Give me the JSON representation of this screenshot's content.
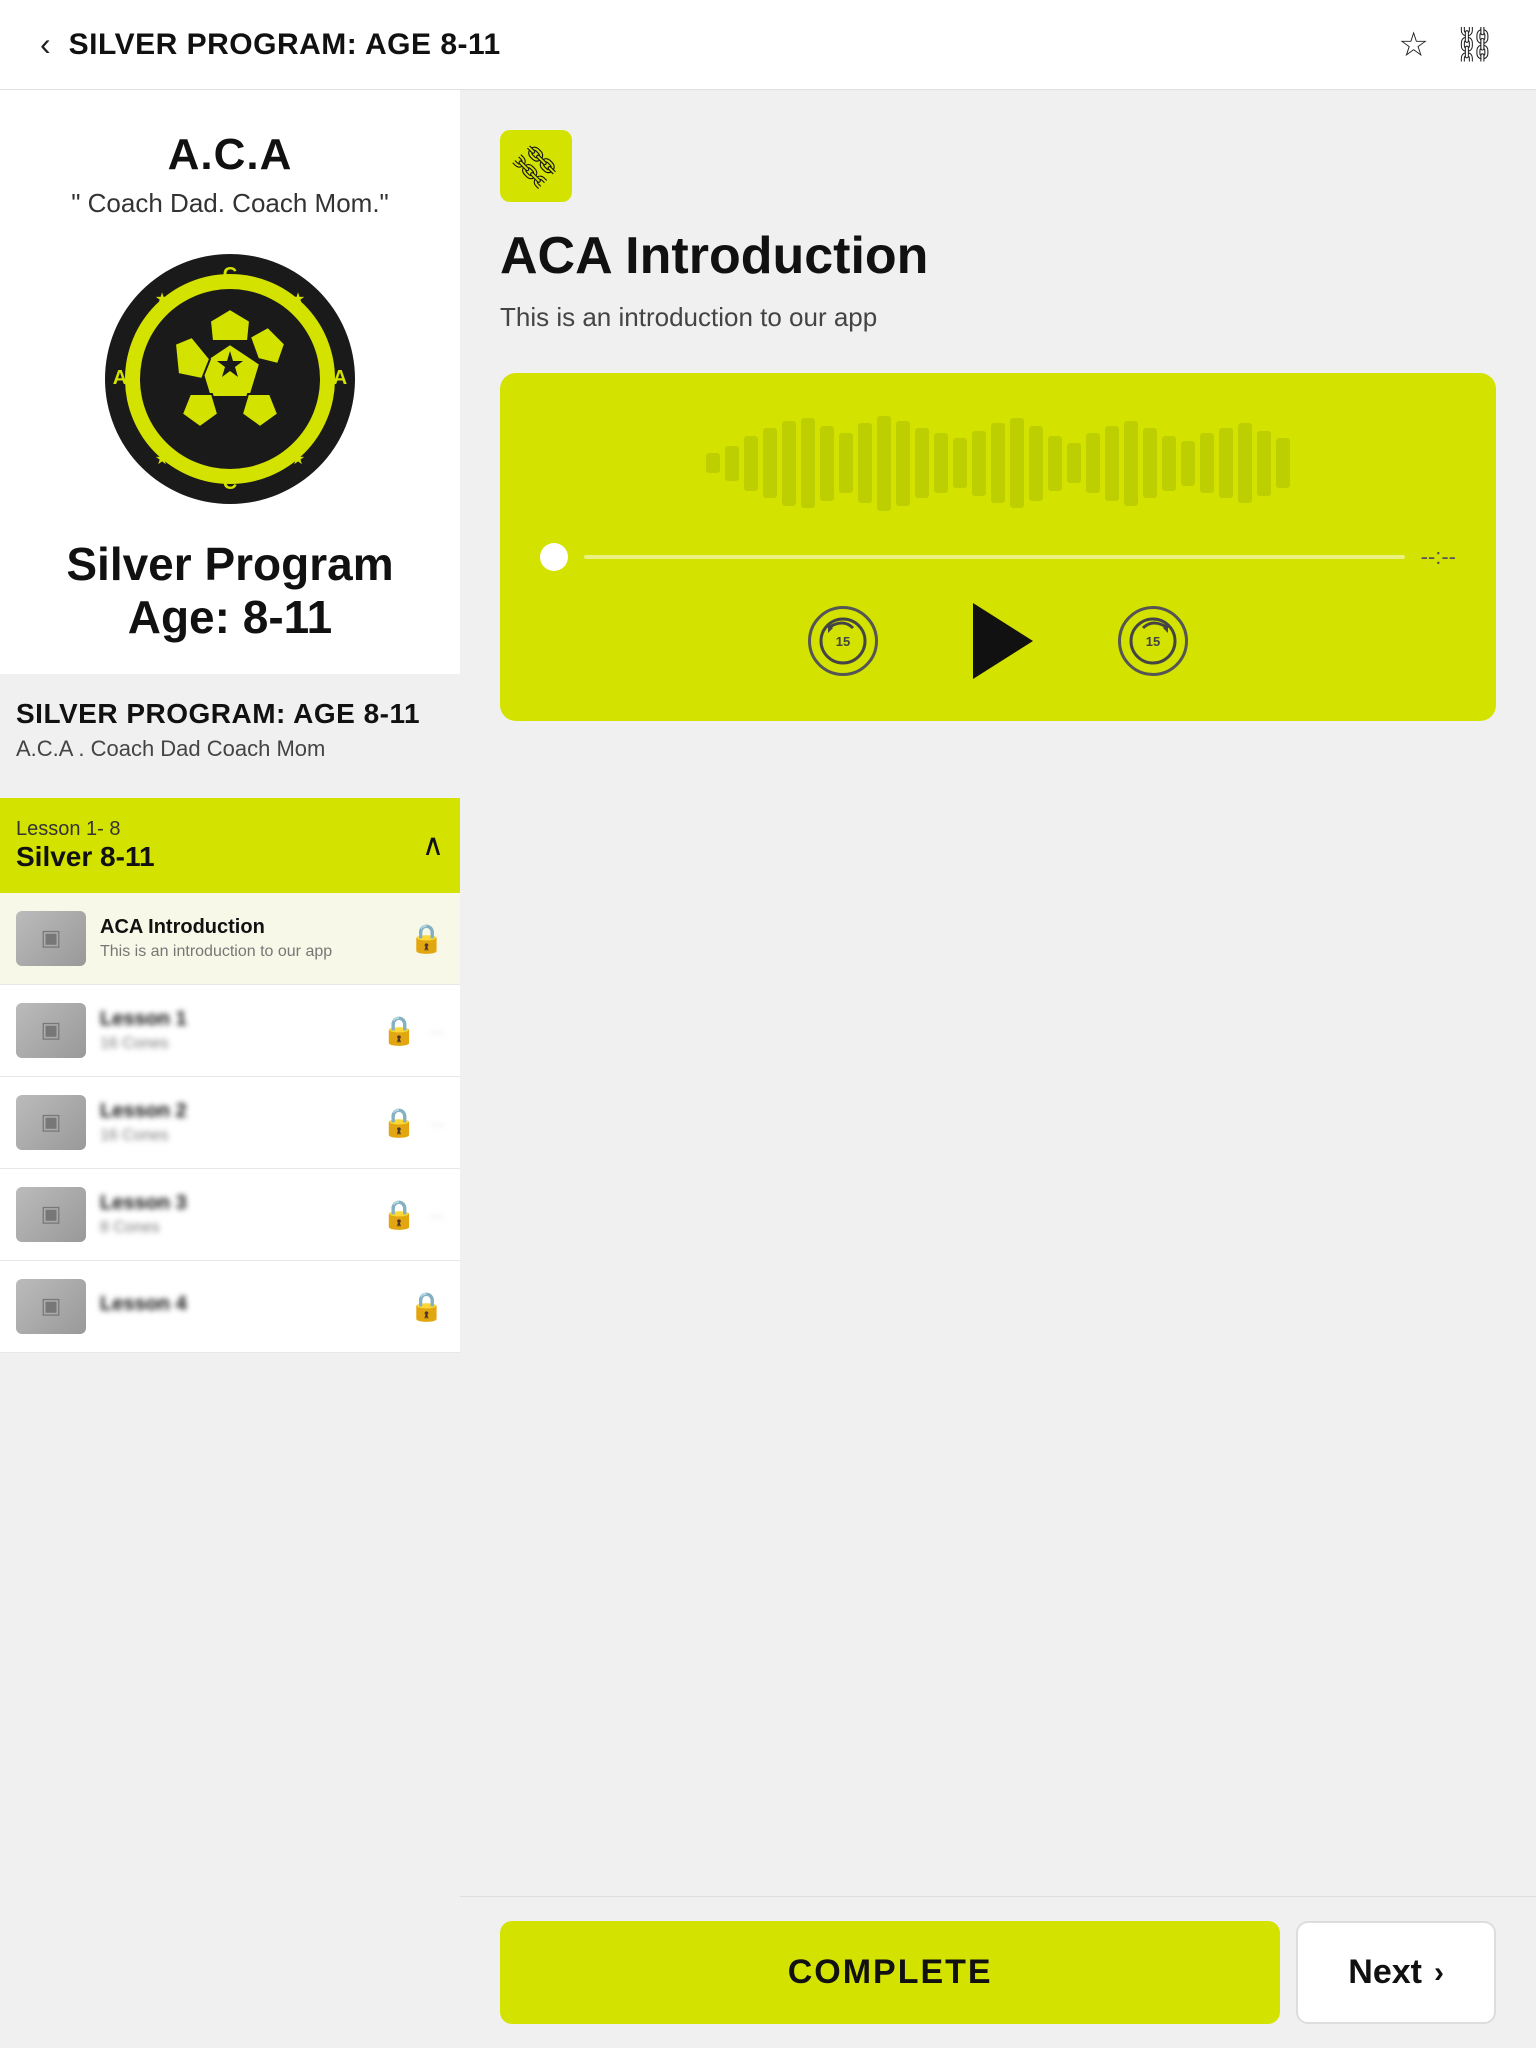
{
  "header": {
    "back_label": "‹",
    "title": "SILVER PROGRAM: AGE 8-11",
    "bookmark_icon": "☆",
    "link_icon": "⛓"
  },
  "course_card": {
    "title": "A.C.A",
    "subtitle": "\" Coach Dad. Coach Mom.\"",
    "program_name": "Silver Program",
    "age_range": "Age: 8-11"
  },
  "course_info": {
    "program_label": "SILVER PROGRAM: AGE 8-11",
    "org_label": "A.C.A . Coach Dad Coach Mom"
  },
  "lesson_section": {
    "label": "Lesson 1- 8",
    "title": "Silver 8-11"
  },
  "lesson_items": [
    {
      "name": "ACA Introduction",
      "sub": "This is an introduction to our app",
      "locked": true,
      "active": true,
      "badge": ""
    },
    {
      "name": "Lesson 1",
      "sub": "16 Cones",
      "locked": true,
      "active": false,
      "badge": "..."
    },
    {
      "name": "Lesson 2",
      "sub": "16 Cones",
      "locked": true,
      "active": false,
      "badge": "..."
    },
    {
      "name": "Lesson 3",
      "sub": "8 Cones",
      "locked": true,
      "active": false,
      "badge": "..."
    },
    {
      "name": "Lesson 4",
      "sub": "",
      "locked": true,
      "active": false,
      "badge": ""
    }
  ],
  "right_panel": {
    "link_icon": "🔗",
    "lesson_title": "ACA Introduction",
    "lesson_desc": "This is an introduction to our app",
    "audio": {
      "time_display": "--:--",
      "waveform_bars": [
        20,
        35,
        55,
        70,
        85,
        90,
        75,
        60,
        80,
        95,
        85,
        70,
        60,
        50,
        65,
        80,
        90,
        75,
        55,
        40,
        60,
        75,
        85,
        70,
        55,
        45,
        60,
        70,
        80,
        65,
        50
      ]
    },
    "controls": {
      "rewind_label": "15",
      "play_label": "▶",
      "forward_label": "15"
    }
  },
  "footer": {
    "complete_label": "COMPLETE",
    "next_label": "Next",
    "next_arrow": "›"
  }
}
